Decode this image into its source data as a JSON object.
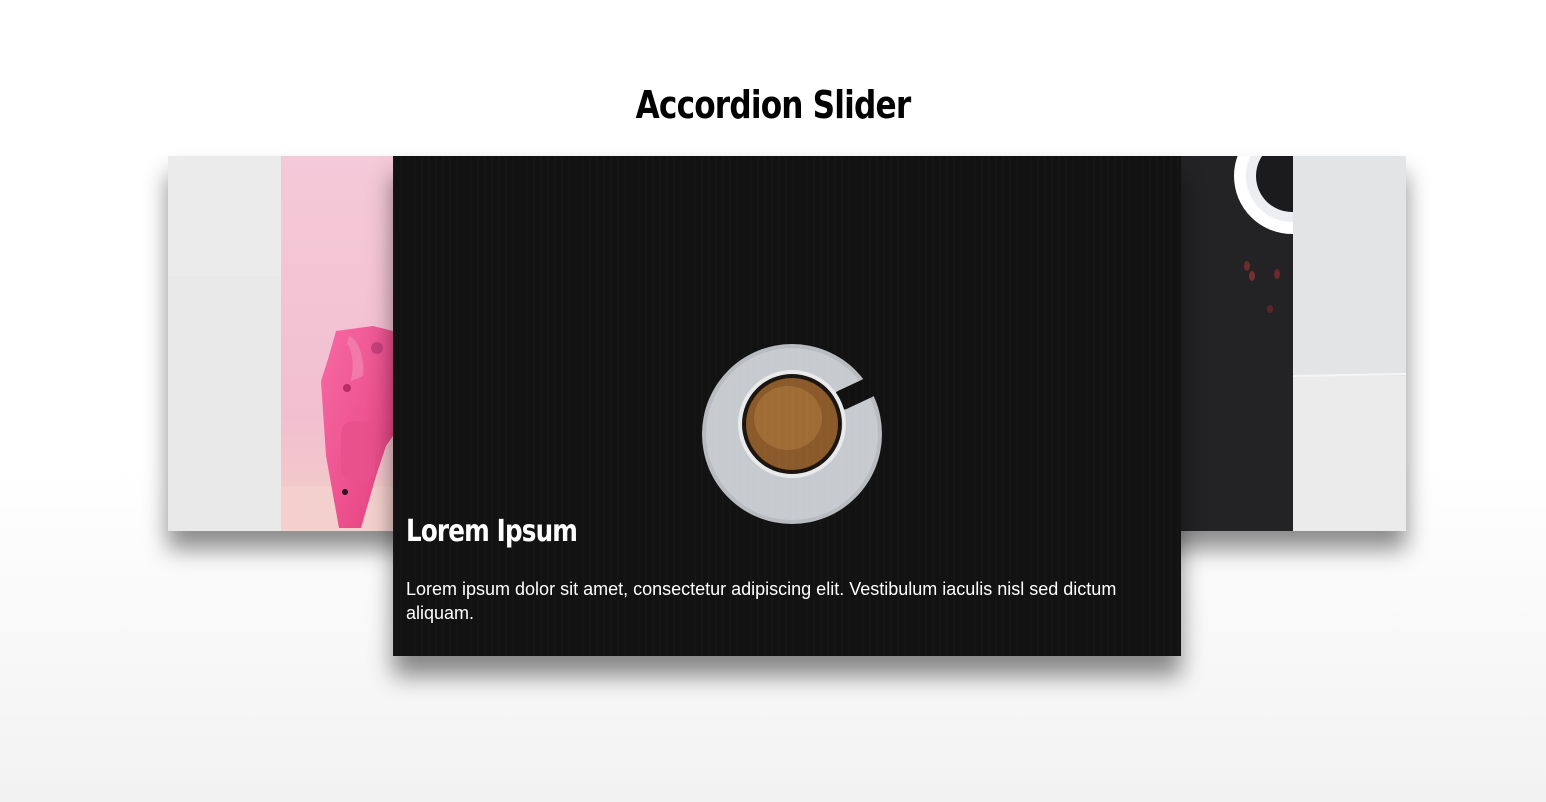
{
  "page": {
    "title": "Accordion Slider"
  },
  "slider": {
    "slides": [
      {
        "name": "slide-1",
        "image": "white-minimal-image"
      },
      {
        "name": "slide-2",
        "image": "pink-toy-pistol-image"
      },
      {
        "name": "slide-3",
        "image": "espresso-cup-image",
        "heading": "Lorem Ipsum",
        "text": "Lorem ipsum dolor sit amet, consectetur adipiscing elit. Vestibulum iaculis nisl sed dictum aliquam.",
        "active": true
      },
      {
        "name": "slide-4",
        "image": "dark-table-coffee-beans-image"
      },
      {
        "name": "slide-5",
        "image": "white-interior-image"
      }
    ]
  },
  "colors": {
    "active_background": "#111111",
    "accent_pink": "#f05a96",
    "text_light": "#ffffff",
    "title": "#000000"
  }
}
